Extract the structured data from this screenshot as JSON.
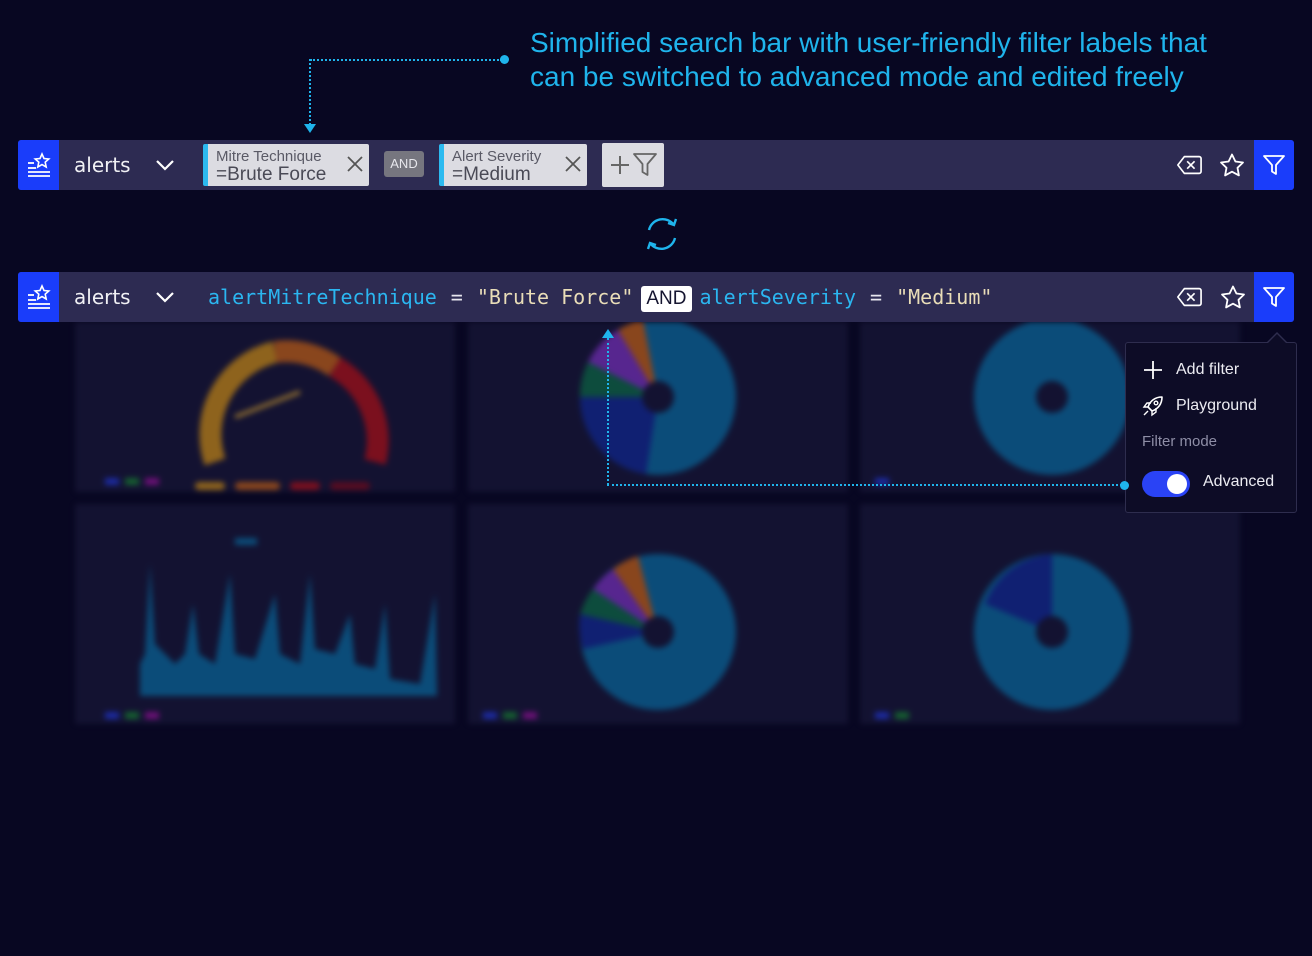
{
  "annotation": {
    "line1": "Simplified search bar with user-friendly filter labels that",
    "line2": "can be switched to advanced mode and edited freely"
  },
  "simple_bar": {
    "index": "alerts",
    "chips": [
      {
        "key": "Mitre Technique",
        "value": "=Brute Force"
      },
      {
        "key": "Alert Severity",
        "value": "=Medium"
      }
    ],
    "operator": "AND"
  },
  "advanced_bar": {
    "index": "alerts",
    "query": {
      "field1": "alertMitreTechnique",
      "op1": "=",
      "value1": "\"Brute Force\"",
      "operator": "AND",
      "field2": "alertSeverity",
      "op2": "=",
      "value2": "\"Medium\""
    }
  },
  "filter_menu": {
    "add_filter": "Add filter",
    "playground": "Playground",
    "section": "Filter mode",
    "toggle_label": "Advanced",
    "toggle_on": true
  },
  "colors": {
    "accent": "#1a3dfa",
    "annotation": "#1fb4ec",
    "background": "#080722",
    "bar": "#2d2b52"
  },
  "icons": {
    "index_icon": "favorite-list-icon",
    "chevron": "chevron-down-icon",
    "clear": "backspace-icon",
    "favorite": "star-icon",
    "filter": "filter-icon",
    "sync": "sync-icon",
    "add_filter": "plus-filter-icon",
    "playground": "rocket-icon"
  }
}
